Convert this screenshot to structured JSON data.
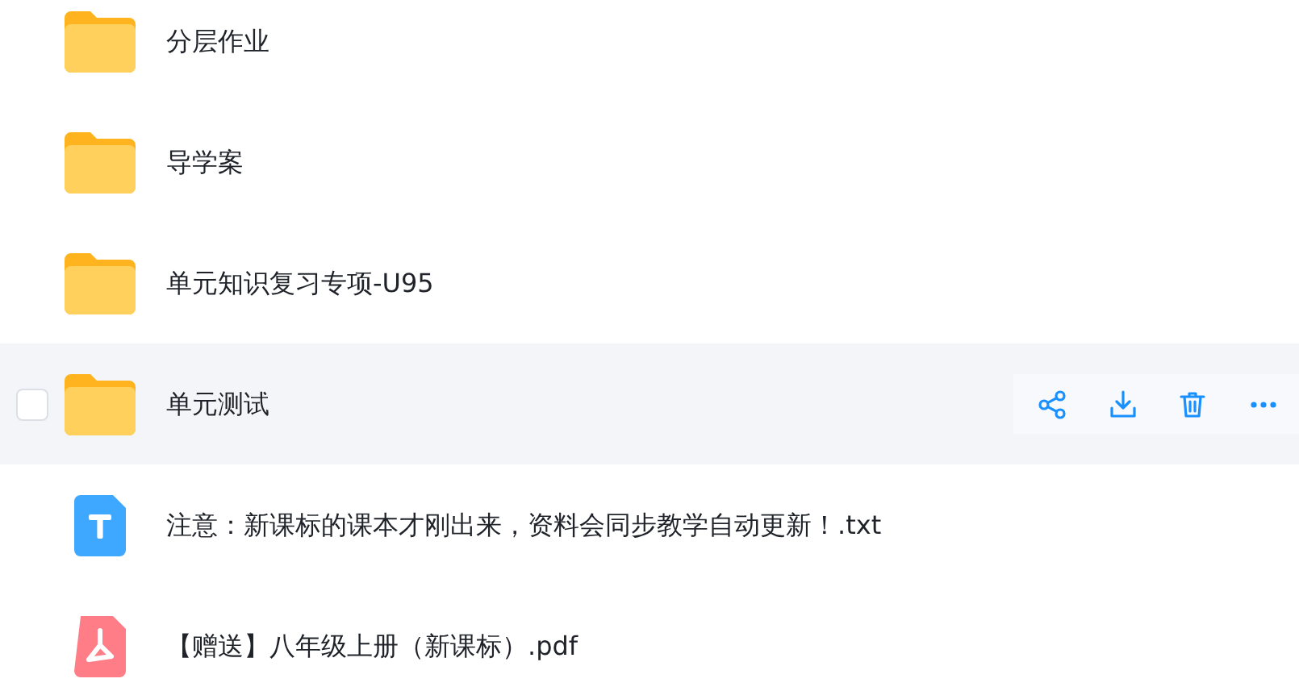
{
  "files": [
    {
      "kind": "folder",
      "name": "分层作业",
      "hovered": false
    },
    {
      "kind": "folder",
      "name": "导学案",
      "hovered": false
    },
    {
      "kind": "folder",
      "name": "单元知识复习专项-U95",
      "hovered": false
    },
    {
      "kind": "folder",
      "name": "单元测试",
      "hovered": true,
      "checked": false
    },
    {
      "kind": "txt",
      "name": "注意：新课标的课本才刚出来，资料会同步教学自动更新！.txt",
      "hovered": false
    },
    {
      "kind": "pdf",
      "name": "【赠送】八年级上册（新课标）.pdf",
      "hovered": false
    }
  ]
}
